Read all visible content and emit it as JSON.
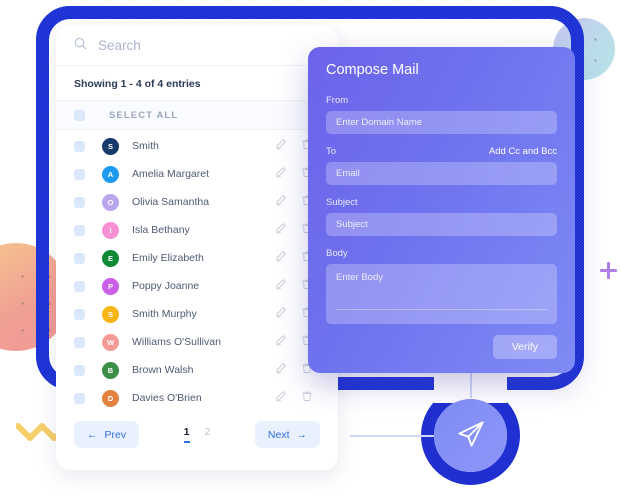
{
  "list_card": {
    "search": {
      "placeholder": "Search",
      "icon": "search-icon"
    },
    "showing_text": "Showing 1 - 4 of 4 entries",
    "select_all_label": "SELECT ALL",
    "row_actions": {
      "edit": "edit-icon",
      "delete": "trash-icon"
    },
    "rows": [
      {
        "initial": "S",
        "name": "Smith",
        "color": "#153a6b"
      },
      {
        "initial": "A",
        "name": "Amelia Margaret",
        "color": "#1e9bf0"
      },
      {
        "initial": "O",
        "name": "Olivia Samantha",
        "color": "#b9a6ee"
      },
      {
        "initial": "I",
        "name": "Isla Bethany",
        "color": "#f78fd4"
      },
      {
        "initial": "E",
        "name": "Emily Elizabeth",
        "color": "#0f8a34"
      },
      {
        "initial": "P",
        "name": "Poppy Joanne",
        "color": "#cc5fe8"
      },
      {
        "initial": "S",
        "name": "Smith Murphy",
        "color": "#f5b614"
      },
      {
        "initial": "W",
        "name": "Williams O'Sullivan",
        "color": "#f59a96"
      },
      {
        "initial": "B",
        "name": "Brown Walsh",
        "color": "#3c8f46"
      },
      {
        "initial": "D",
        "name": "Davies O'Brien",
        "color": "#e38140"
      }
    ],
    "pagination": {
      "prev_label": "Prev",
      "next_label": "Next",
      "pages": [
        "1",
        "2"
      ],
      "active_page": "1"
    }
  },
  "compose": {
    "title": "Compose Mail",
    "from_label": "From",
    "from_placeholder": "Enter Domain Name",
    "to_label": "To",
    "cc_bcc_label": "Add Cc and Bcc",
    "to_placeholder": "Email",
    "subject_label": "Subject",
    "subject_placeholder": "Subject",
    "body_label": "Body",
    "body_placeholder": "Enter Body",
    "verify_label": "Verify"
  },
  "decor": {
    "send_icon": "paper-plane-icon",
    "plus_icon": "plus-icon",
    "squiggle_icon": "squiggle-icon",
    "frame_color": "#1f2fd0",
    "accent_color": "#6b63ea",
    "link_color": "#2f6fe0"
  }
}
